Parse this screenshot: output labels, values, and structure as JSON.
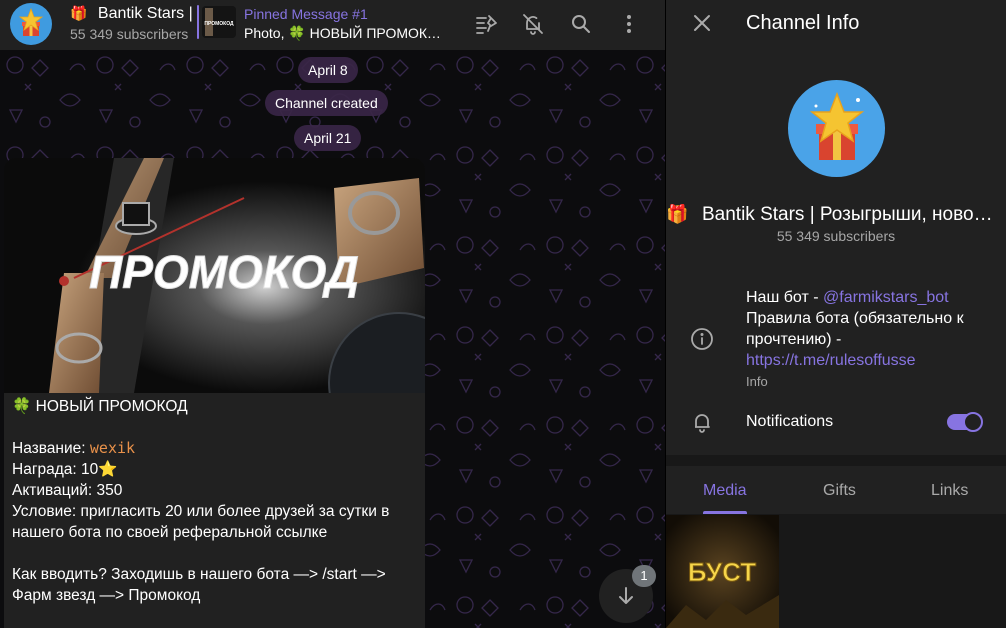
{
  "header": {
    "gift_emoji": "🎁",
    "title": "Bantik Stars | Розыгрыши, новости",
    "subscribers": "55 349 subscribers",
    "pinned_title": "Pinned Message #1",
    "pinned_text": "Photo, 🍀 НОВЫЙ ПРОМОКОД",
    "pinned_thumb_text": "ПРОМОКОД"
  },
  "chat": {
    "date_1": "April 8",
    "service_message": "Channel created",
    "date_2": "April 21",
    "image_text": "ПРОМОКОД",
    "message": {
      "line1_emoji": "🍀",
      "line1": "НОВЫЙ ПРОМОКОД",
      "name_label": "Название:",
      "code": "wexik",
      "reward_label": "Награда: 10",
      "reward_emoji": "⭐",
      "activations": "Активаций: 350",
      "condition_1": "Условие: пригласить 20 или более друзей за сутки в",
      "condition_2": "нашего бота по своей реферальной ссылке",
      "howto_1": "Как вводить? Заходишь в нашего бота —> /start —>",
      "howto_2": "Фарм звезд —> Промокод"
    },
    "unread_count": "1"
  },
  "info": {
    "panel_title": "Channel Info",
    "gift_emoji": "🎁",
    "channel_name": "Bantik Stars | Розыгрыши, новости",
    "subscribers": "55 349 subscribers",
    "desc_prefix": "Наш бот - ",
    "bot_link": "@farmikstars_bot",
    "desc_line2": "Правила бота (обязательно к",
    "desc_line3": "прочтению) -",
    "rules_link": "https://t.me/rulesoffusse",
    "desc_label": "Info",
    "notifications_label": "Notifications",
    "notifications_enabled": true,
    "tabs": [
      "Media",
      "Gifts",
      "Links"
    ],
    "active_tab": "Media",
    "media_thumb_text": "БУСТ"
  },
  "colors": {
    "accent": "#8774e1",
    "panel": "#212121",
    "code": "#e8914a"
  }
}
